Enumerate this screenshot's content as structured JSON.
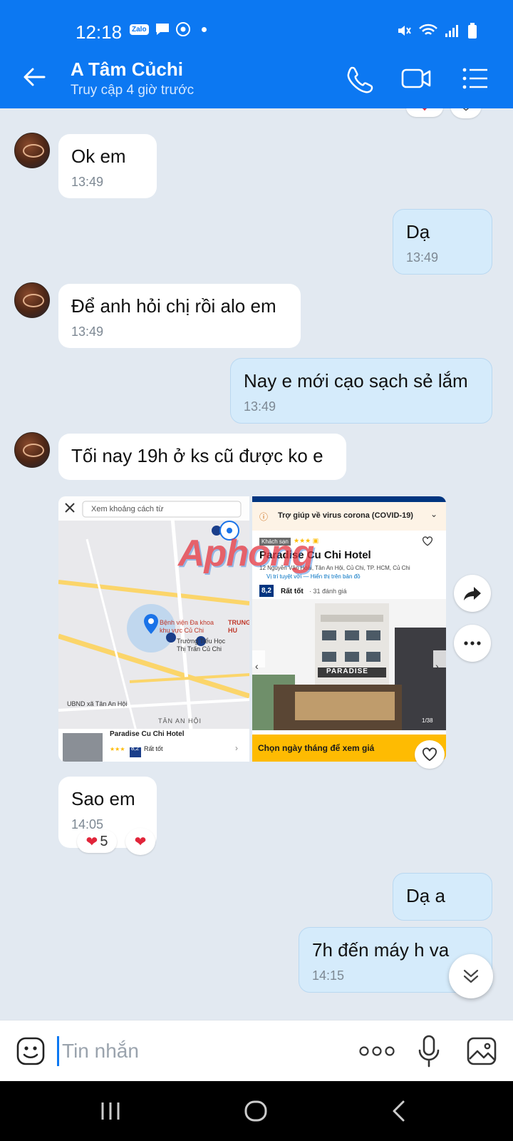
{
  "status_bar": {
    "time": "12:18",
    "app_chip": "Zalo"
  },
  "header": {
    "name": "A Tâm Củchi",
    "status": "Truy cập 4 giờ trước"
  },
  "messages": [
    {
      "id": "m1",
      "text": "Ok em",
      "time": "13:49",
      "side": "in"
    },
    {
      "id": "m2",
      "text": "Dạ",
      "time": "13:49",
      "side": "out"
    },
    {
      "id": "m3",
      "text": "Để anh hỏi chị rồi alo em",
      "time": "13:49",
      "side": "in"
    },
    {
      "id": "m4",
      "text": "Nay e mới cạo sạch sẻ lắm",
      "time": "13:49",
      "side": "out"
    },
    {
      "id": "m5",
      "text": "Tối nay 19h ở ks cũ được ko e",
      "time": "",
      "side": "in"
    },
    {
      "id": "m6",
      "text": "Sao em",
      "time": "14:05",
      "side": "in"
    },
    {
      "id": "m7",
      "text": "Dạ a",
      "time": "",
      "side": "out"
    },
    {
      "id": "m8",
      "text": "7h đến máy h va",
      "time": "14:15",
      "side": "out"
    }
  ],
  "reactions": {
    "m6_count": "5"
  },
  "map_image": {
    "search_placeholder": "Xem khoảng cách từ",
    "hospital_label": "Bệnh viện Đa khoa khu vực Củ Chi",
    "school_label": "Trường Tiểu Học Thị Trấn Củ Chi",
    "ubnd_label": "UBND xã Tân An Hội",
    "area_label": "TÂN AN HỘI",
    "center_label": "TRUNG HU",
    "hotel_name": "Paradise Cu Chi Hotel",
    "rating": "8,2",
    "rating_text": "Rất tốt"
  },
  "hotel_image": {
    "covid_banner": "Trợ giúp về virus corona (COVID-19)",
    "type_badge": "Khách sạn",
    "hotel_name": "Paradise Cu Chi Hotel",
    "address": "12 Nguyễn Văn Hoài, Tân An Hội, Củ Chi, TP. HCM, Củ Chi",
    "location_note": "Vị trí tuyệt vời — Hiển thị trên bản đồ",
    "rating": "8,2",
    "rating_text": "Rất tốt",
    "reviews": "· 31 đánh giá",
    "sign_text": "PARADISE",
    "photo_counter": "1/38",
    "cta": "Chọn ngày tháng để xem giá"
  },
  "watermark": "Aphong",
  "composer": {
    "placeholder": "Tin nhắn"
  },
  "colors": {
    "brand_blue": "#0c78f2",
    "chat_bg": "#e2e9f1",
    "out_bubble": "#d5ebfb",
    "heart": "#e1253a",
    "hotel_cta_bg": "#febb02"
  }
}
